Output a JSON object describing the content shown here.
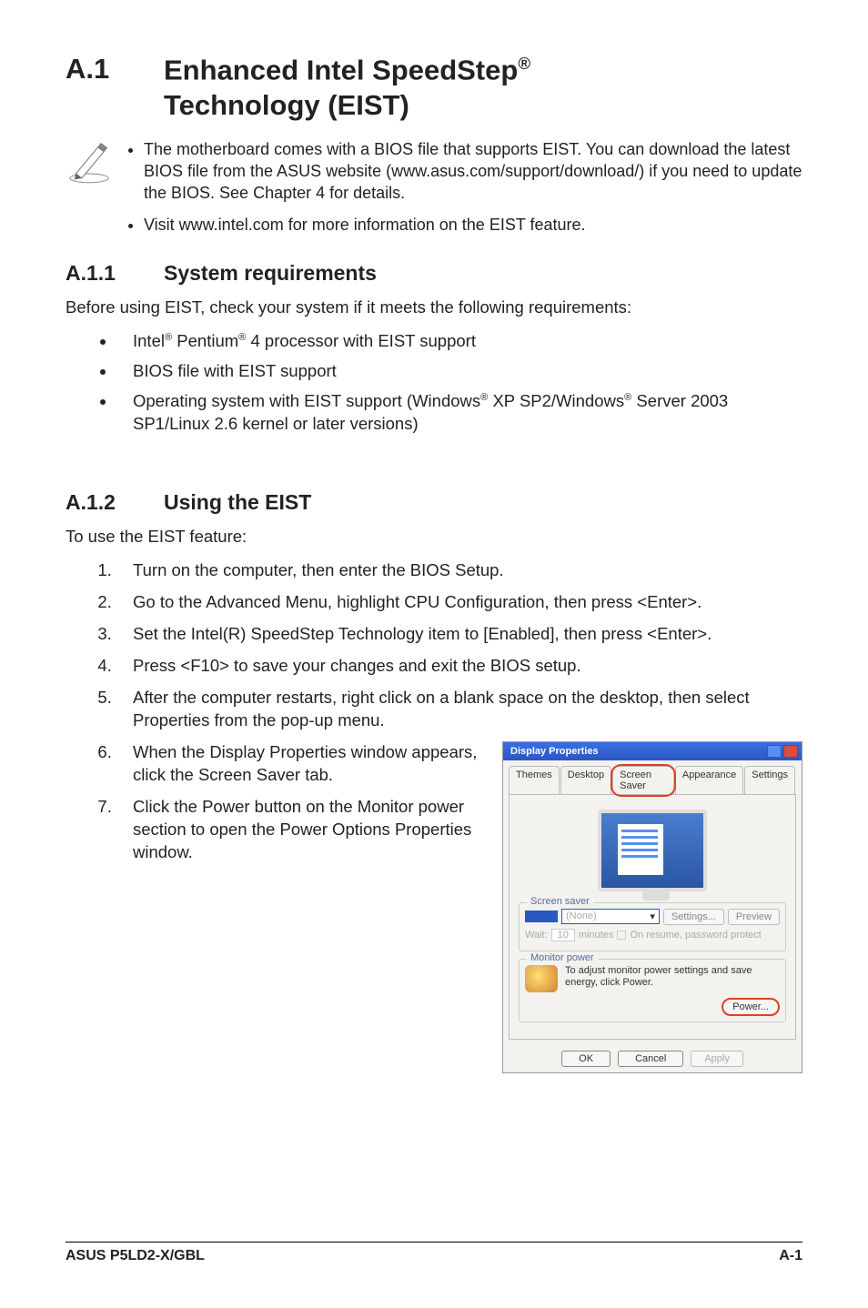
{
  "h1": {
    "num": "A.1",
    "text_a": "Enhanced Intel SpeedStep",
    "text_b": "Technology (EIST)"
  },
  "note": {
    "items": [
      "The motherboard comes with a BIOS file that supports EIST. You can download the latest BIOS file from the ASUS website (www.asus.com/support/download/) if you need to update the BIOS. See Chapter 4 for details.",
      "Visit www.intel.com for more information on the EIST feature."
    ]
  },
  "sec_a11": {
    "num": "A.1.1",
    "title": "System requirements",
    "intro": "Before using EIST, check your system if it meets the following requirements:",
    "bullets": [
      {
        "pre": "Intel",
        "sup1": "®",
        "mid": " Pentium",
        "sup2": "®",
        "post": " 4 processor with EIST support"
      },
      {
        "text": "BIOS file with EIST support"
      },
      {
        "pre": "Operating system with EIST support (Windows",
        "sup1": "®",
        "mid": " XP SP2/Windows",
        "sup2": "®",
        "post": " Server 2003 SP1/Linux 2.6 kernel or later versions)"
      }
    ]
  },
  "sec_a12": {
    "num": "A.1.2",
    "title": "Using the EIST",
    "intro": "To use the EIST feature:",
    "steps": [
      "Turn on the computer, then enter the BIOS Setup.",
      "Go to the Advanced Menu, highlight CPU Configuration, then press <Enter>.",
      "Set the Intel(R) SpeedStep Technology item to [Enabled], then press <Enter>.",
      "Press <F10> to save your changes and exit the BIOS setup.",
      "After the computer restarts, right click on a blank space on the desktop, then select Properties from the pop-up menu.",
      "When the Display Properties window appears, click the Screen Saver tab.",
      "Click the Power button on the Monitor power section to open the Power Options Properties window."
    ]
  },
  "screenshot": {
    "title": "Display Properties",
    "tabs": [
      "Themes",
      "Desktop",
      "Screen Saver",
      "Appearance",
      "Settings"
    ],
    "fieldset1": {
      "legend": "Screen saver",
      "select_value": "(None)",
      "btn_settings": "Settings...",
      "btn_preview": "Preview",
      "wait_label": "Wait:",
      "wait_value": "10",
      "wait_unit": "minutes",
      "resume_label": "On resume, password protect"
    },
    "fieldset2": {
      "legend": "Monitor power",
      "text": "To adjust monitor power settings and save energy, click Power.",
      "btn_power": "Power..."
    },
    "bottom": {
      "ok": "OK",
      "cancel": "Cancel",
      "apply": "Apply"
    }
  },
  "footer": {
    "left": "ASUS P5LD2-X/GBL",
    "right": "A-1"
  }
}
